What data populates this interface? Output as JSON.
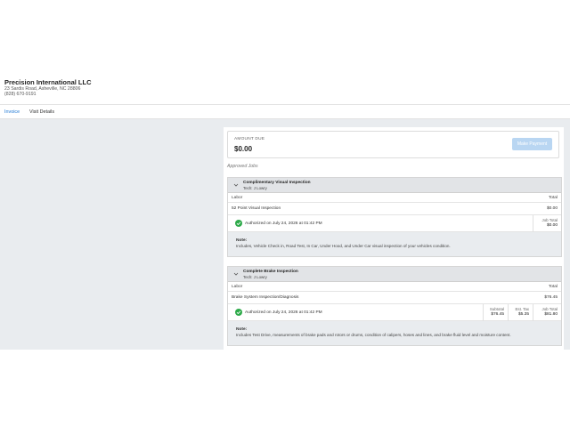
{
  "company": {
    "name": "Precision International LLC",
    "address": "23 Sardis Road, Asheville, NC 28806",
    "phone": "(828) 670-9191"
  },
  "tabs": [
    {
      "label": "Invoice",
      "active": true
    },
    {
      "label": "Visit Details",
      "active": false
    }
  ],
  "amount_due": {
    "label": "AMOUNT DUE",
    "value": "$0.00",
    "button_label": "Make Payment"
  },
  "section_title": "Approved Jobs",
  "jobs": [
    {
      "title": "Complimentary Visual Inspection",
      "tech": "Tech: J Lowry",
      "labor_header": "Labor",
      "total_header": "Total",
      "item_name": "52 Point Visual Inspection",
      "item_total": "$0.00",
      "authorized": "Authorized on July 24, 2026 at 01:42 PM",
      "job_total_label": "Job Total",
      "job_total": "$0.00",
      "note_label": "Note:",
      "note_text": "Includes, Vehicle Check in, Road Test, In Car, Under Hood, and Under Car visual inspection of your vehicles condition."
    },
    {
      "title": "Complete Brake Inspection",
      "tech": "Tech: J Lowry",
      "labor_header": "Labor",
      "total_header": "Total",
      "item_name": "Brake System Inspection/Diagnosis",
      "item_total": "$76.45",
      "authorized": "Authorized on July 24, 2026 at 01:42 PM",
      "subtotal_label": "Subtotal",
      "subtotal": "$76.45",
      "tax_label": "Est. Tax",
      "tax": "$5.35",
      "job_total_label": "Job Total",
      "job_total": "$81.80",
      "note_label": "Note:",
      "note_text": "Includes Test Drive, measurements of brake pads and rotors or drums, condition of calipers, hoses and lines, and brake fluid level and moisture content."
    }
  ],
  "icons": {
    "chevron": "chevron-down-icon",
    "check": "check-circle-icon"
  },
  "colors": {
    "accent": "#1e77d3",
    "button_disabled": "#b9d6f2",
    "success": "#2eaa4a",
    "background": "#e9ecef"
  }
}
